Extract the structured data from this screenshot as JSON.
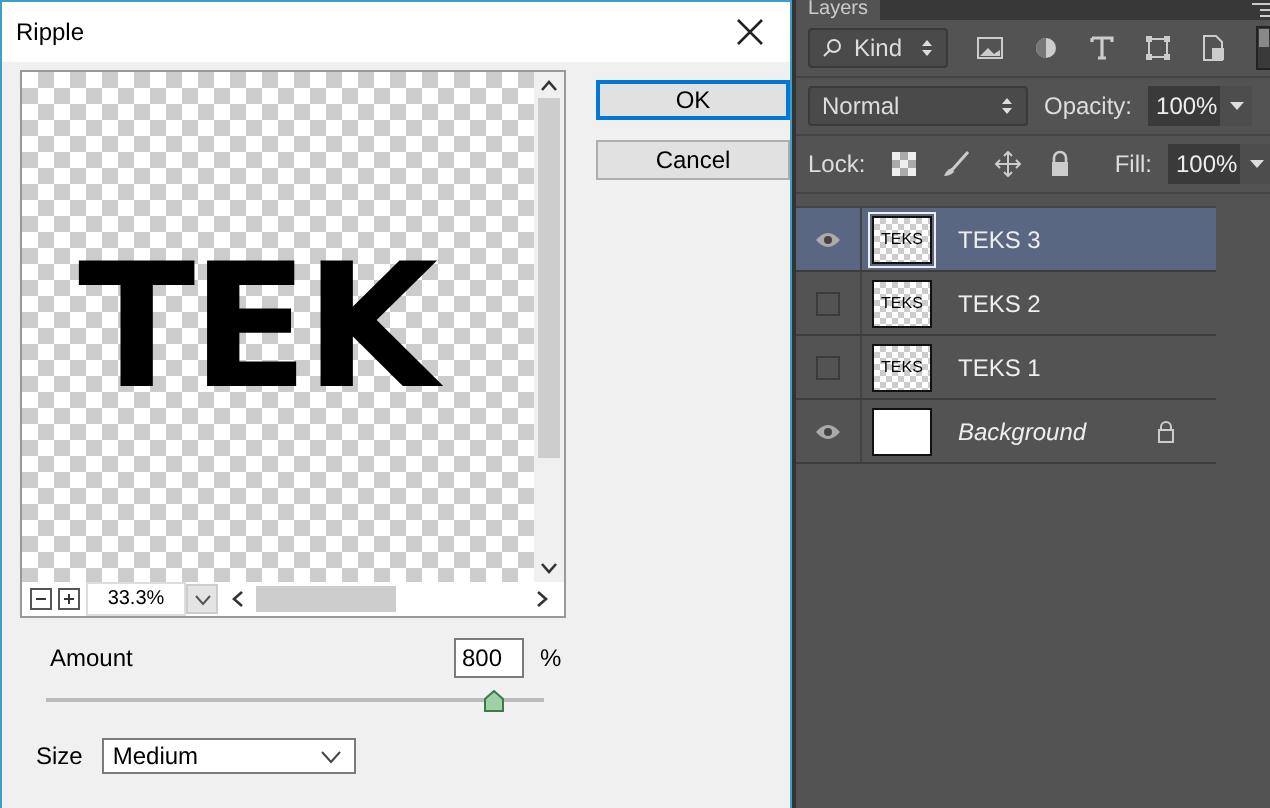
{
  "dialog": {
    "title": "Ripple",
    "preview": {
      "text": "TEK",
      "zoom": "33.3%"
    },
    "buttons": [
      {
        "label": "OK",
        "selected": true
      },
      {
        "label": "Cancel",
        "selected": false
      }
    ],
    "amount": {
      "label": "Amount",
      "value": "800",
      "unit": "%",
      "level": 0.9
    },
    "size": {
      "label": "Size",
      "value": "Medium"
    }
  },
  "layers_panel": {
    "tab": "Layers",
    "filter": "Kind",
    "blend_mode": "Normal",
    "opacity_label": "Opacity:",
    "opacity": "100%",
    "lock_label": "Lock:",
    "fill_label": "Fill:",
    "fill": "100%",
    "layers": [
      {
        "name": "TEKS 3",
        "thumb_text": "TEKS",
        "kind": "text",
        "visible": true,
        "selected": true,
        "locked": false
      },
      {
        "name": "TEKS 2",
        "thumb_text": "TEKS",
        "kind": "text",
        "visible": false,
        "selected": false,
        "locked": false
      },
      {
        "name": "TEKS 1",
        "thumb_text": "TEKS",
        "kind": "text",
        "visible": false,
        "selected": false,
        "locked": false
      },
      {
        "name": "Background",
        "kind": "background",
        "visible": true,
        "selected": false,
        "locked": true
      }
    ]
  }
}
